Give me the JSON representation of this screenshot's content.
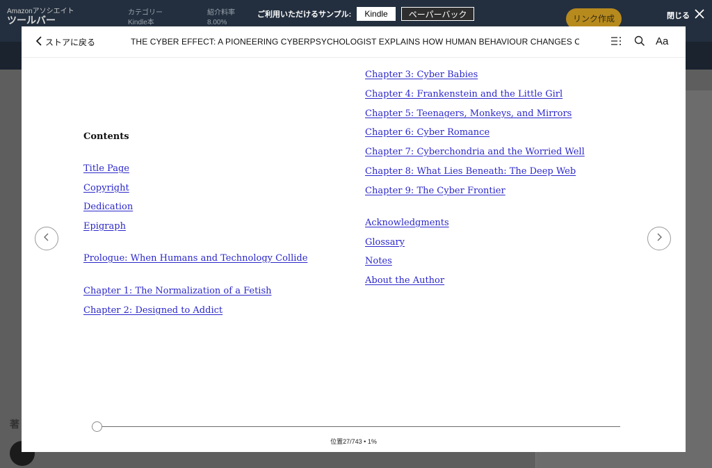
{
  "background": {
    "associate_title": "Amazonアソシエイト",
    "associate_tool": "ツールバー",
    "category_label": "カテゴリー",
    "category_value": "Kindle本",
    "rate_label": "紹介料率",
    "rate_value": "8.00%",
    "link_button": "リンク作成",
    "section_heading": "著"
  },
  "sample_bar": {
    "label": "ご利用いただけるサンプル:",
    "options": [
      "Kindle",
      "ペーパーバック"
    ],
    "selected": "Kindle"
  },
  "close": {
    "label": "閉じる"
  },
  "reader": {
    "back_label": "ストアに戻る",
    "title": "THE CYBER EFFECT: A PIONEERING CYBERPSYCHOLOGIST EXPLAINS HOW HUMAN BEHAVIOUR CHANGES ONLIN…",
    "font_button": "Aa",
    "icons": [
      "toc-icon",
      "search-icon",
      "chevron-left-icon",
      "chevron-right-icon",
      "close-icon"
    ],
    "contents_heading": "Contents",
    "left_links": [
      "Title Page",
      "Copyright",
      "Dedication",
      "Epigraph",
      "Prologue: When Humans and Technology Collide",
      "Chapter 1: The Normalization of a Fetish",
      "Chapter 2: Designed to Addict"
    ],
    "right_links": [
      "Chapter 3: Cyber Babies",
      "Chapter 4: Frankenstein and the Little Girl",
      "Chapter 5: Teenagers, Monkeys, and Mirrors",
      "Chapter 6: Cyber Romance",
      "Chapter 7: Cyberchondria and the Worried Well",
      "Chapter 8: What Lies Beneath: The Deep Web",
      "Chapter 9: The Cyber Frontier",
      "Acknowledgments",
      "Glossary",
      "Notes",
      "About the Author"
    ],
    "progress_fraction": 0.01,
    "location_text": "位置27/743 • 1%"
  }
}
